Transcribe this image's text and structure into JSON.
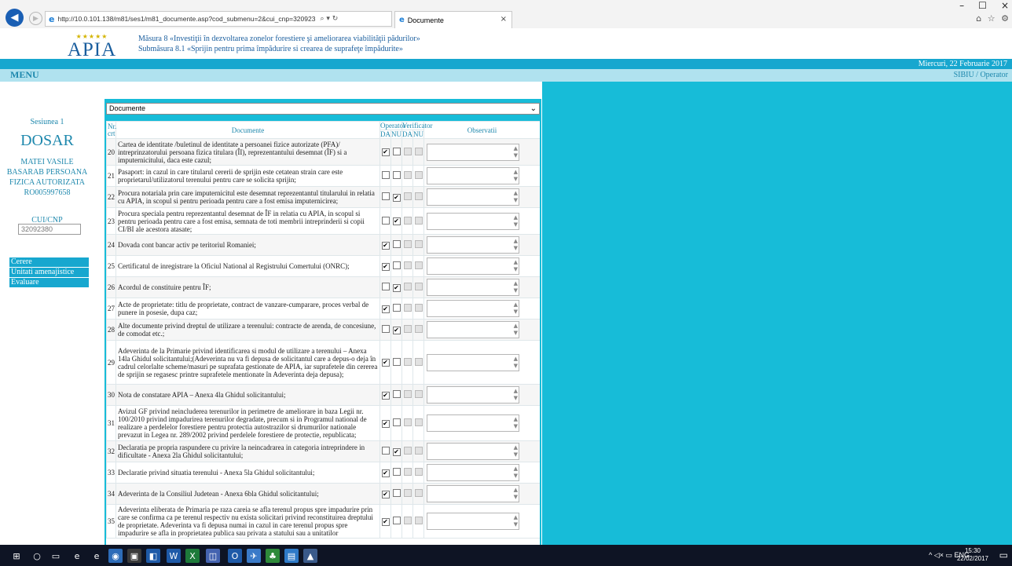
{
  "browser": {
    "url": "http://10.0.101.138/m81/ses1/m81_documente.asp?cod_submenu=2&cui_cnp=320923",
    "url_tools": "⌕ ▾ ↻",
    "tab_title": "Documente",
    "window_controls": [
      "–",
      "☐",
      "×"
    ],
    "toolbar_icons": "⌂ ☆ ⚙"
  },
  "header": {
    "logo_text": "APIA",
    "logo_stars": "★★★★★",
    "title_line1": "Măsura 8 «Investiţii în dezvoltarea zonelor forestiere şi ameliorarea viabilităţii pădurilor»",
    "title_line2": "Submăsura 8.1 «Sprijin pentru prima împădurire si crearea de suprafeţe împădurite»",
    "date": "Miercuri, 22 Februarie 2017",
    "menu_label": "MENU",
    "user": "SIBIU / Operator"
  },
  "sidebar": {
    "session": "Sesiunea 1",
    "dosar": "DOSAR",
    "person_name": [
      "MATEI VASILE",
      "BASARAB PERSOANA",
      "FIZICA AUTORIZATA",
      "RO005997658"
    ],
    "cui_label": "CUI/CNP",
    "cui_value": "32092380",
    "nav": [
      "Cerere",
      "Unitati amenajistice",
      "Evaluare"
    ]
  },
  "panel": {
    "select_value": "Documente",
    "table": {
      "headers": {
        "nr": "Nr. crt",
        "documente": "Documente",
        "operator": "Operator",
        "verificator": "Verificator",
        "da": "DA",
        "nu": "NU",
        "observatii": "Observatii"
      },
      "rows": [
        {
          "nr": "20",
          "text": "Cartea de identitate /buletinul de identitate a persoanei fizice autorizate (PFA)/ intreprinzatorului persoana fizica titulara (ÎI), reprezentantului desemnat (ÎF) si a imputernicitului, daca este cazul;",
          "op_da": true,
          "op_nu": false
        },
        {
          "nr": "21",
          "text": "Pasaport: in cazul in care titularul cererii de sprijin este cetatean strain care este proprietarul/utilizatorul terenului pentru care se solicita sprijin;",
          "op_da": false,
          "op_nu": false
        },
        {
          "nr": "22",
          "text": "Procura notariala prin care imputernicitul este desemnat reprezentantul titularului in relatia cu APIA, in scopul si pentru perioada pentru care a fost emisa imputernicirea;",
          "op_da": false,
          "op_nu": true
        },
        {
          "nr": "23",
          "text": "Procura speciala pentru reprezentantul desemnat de ÎF in relatia cu APIA, in scopul si pentru perioada pentru care a fost emisa, semnata de toti membrii intreprinderii si copii CI/BI ale acestora atasate;",
          "op_da": false,
          "op_nu": true
        },
        {
          "nr": "24",
          "text": "Dovada cont bancar activ pe teritoriul Romaniei;",
          "op_da": true,
          "op_nu": false
        },
        {
          "nr": "25",
          "text": "Certificatul de inregistrare la Oficiul National al Registrului Comertului (ONRC);",
          "op_da": true,
          "op_nu": false
        },
        {
          "nr": "26",
          "text": "Acordul de constituire pentru ÎF;",
          "op_da": false,
          "op_nu": true
        },
        {
          "nr": "27",
          "text": "Acte de proprietate: titlu de proprietate, contract de vanzare-cumparare, proces verbal de punere in posesie, dupa caz;",
          "op_da": true,
          "op_nu": false
        },
        {
          "nr": "28",
          "text": "Alte documente privind dreptul de utilizare a terenului: contracte de arenda, de concesiune, de comodat etc.;",
          "op_da": false,
          "op_nu": true
        },
        {
          "nr": "29",
          "text": "Adeverinta de la Primarie privind identificarea si modul de utilizare a terenului – Anexa 14la Ghidul solicitantului;(Adeverinta nu va fi depusa de solicitantul care a depus-o deja în cadrul celorlalte scheme/masuri pe suprafata gestionate de APIA, iar suprafetele din cererea de sprijin se regasesc printre suprafetele mentionate în Adeverinta deja depusa);",
          "op_da": true,
          "op_nu": false
        },
        {
          "nr": "30",
          "text": "Nota de constatare APIA – Anexa 4la Ghidul solicitantului;",
          "op_da": true,
          "op_nu": false
        },
        {
          "nr": "31",
          "text": "Avizul GF privind neincluderea terenurilor in perimetre de ameliorare in baza Legii nr. 100/2010 privind impadurirea terenurilor degradate, precum si in Programul national de realizare a perdelelor forestiere pentru protectia autostrazilor si drumurilor nationale prevazut in Legea nr. 289/2002 privind perdelele forestiere de protectie, republicata;",
          "op_da": true,
          "op_nu": false
        },
        {
          "nr": "32",
          "text": "Declaratia pe propria raspundere cu privire la neincadrarea in categoria intreprindere in dificultate - Anexa 2la Ghidul solicitantului;",
          "op_da": false,
          "op_nu": true
        },
        {
          "nr": "33",
          "text": "Declaratie privind situatia terenului - Anexa 5la Ghidul solicitantului;",
          "op_da": true,
          "op_nu": false
        },
        {
          "nr": "34",
          "text": "Adeverinta de la Consiliul Judetean - Anexa 6bla Ghidul solicitantului;",
          "op_da": true,
          "op_nu": false
        },
        {
          "nr": "35",
          "text": "Adeverinta eliberata de Primaria pe raza careia se afla terenul propus spre impadurire prin care se confirma ca pe terenul respectiv nu exista solicitari privind reconstituirea dreptului de proprietate. Adeverinta va fi depusa numai in cazul in care terenul propus spre impadurire se afla in proprietatea publica sau privata a statului sau a unitatilor",
          "op_da": true,
          "op_nu": false
        }
      ]
    }
  },
  "taskbar": {
    "items": [
      "⊞",
      "○",
      "▭",
      "e",
      "e",
      "◉",
      "▣",
      "◧",
      "W",
      "X",
      "◫",
      "O",
      "✈",
      "♣",
      "▤",
      "▲"
    ],
    "tray": "^ ◁× ▭ ENG",
    "time": "15:30",
    "date": "22/02/2017",
    "notif": "▭"
  },
  "colors": {
    "cyan": "#17a7cf",
    "panel": "#17bcd8",
    "light": "#b0e2ef",
    "text_blue": "#1e88ad",
    "logo_blue": "#1a5e9e"
  }
}
